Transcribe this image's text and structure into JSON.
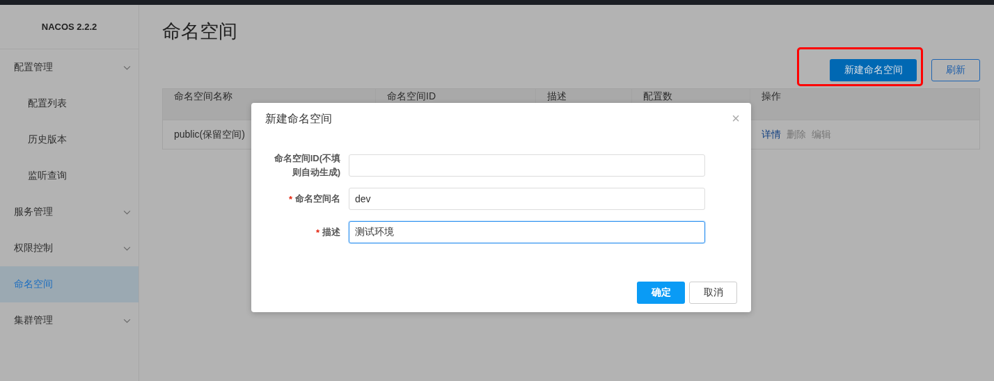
{
  "sidebar": {
    "logo": "NACOS 2.2.2",
    "items": [
      {
        "label": "配置管理",
        "kind": "group",
        "selected": false,
        "children": [
          {
            "label": "配置列表",
            "selected": false
          },
          {
            "label": "历史版本",
            "selected": false
          },
          {
            "label": "监听查询",
            "selected": false
          }
        ]
      },
      {
        "label": "服务管理",
        "kind": "group",
        "selected": false
      },
      {
        "label": "权限控制",
        "kind": "group",
        "selected": false
      },
      {
        "label": "命名空间",
        "kind": "link",
        "selected": true
      },
      {
        "label": "集群管理",
        "kind": "group",
        "selected": false
      }
    ]
  },
  "page": {
    "title": "命名空间",
    "buttons": [
      {
        "label": "新建命名空间",
        "kind": "primary",
        "highlighted": true
      },
      {
        "label": "刷新",
        "kind": "outline",
        "highlighted": false
      }
    ]
  },
  "table": {
    "columns": [
      "命名空间名称",
      "命名空间ID",
      "描述",
      "配置数",
      "操作"
    ],
    "rows": [
      {
        "name": "public(保留空间)",
        "actions": [
          {
            "label": "详情",
            "disabled": false
          },
          {
            "label": "删除",
            "disabled": true
          },
          {
            "label": "编辑",
            "disabled": true
          }
        ]
      }
    ]
  },
  "dialog": {
    "title": "新建命名空间",
    "close": "×",
    "required_mark": "*",
    "fields": [
      {
        "label": "命名空间ID(不填则自动生成)",
        "required": false,
        "focused": false
      },
      {
        "label": "命名空间名",
        "required": true,
        "focused": false,
        "value": "dev"
      },
      {
        "label": "描述",
        "required": true,
        "focused": true,
        "value": "测试环境"
      }
    ],
    "buttons": [
      {
        "label": "确定",
        "kind": "primary"
      },
      {
        "label": "取消",
        "kind": "secondary"
      }
    ]
  }
}
